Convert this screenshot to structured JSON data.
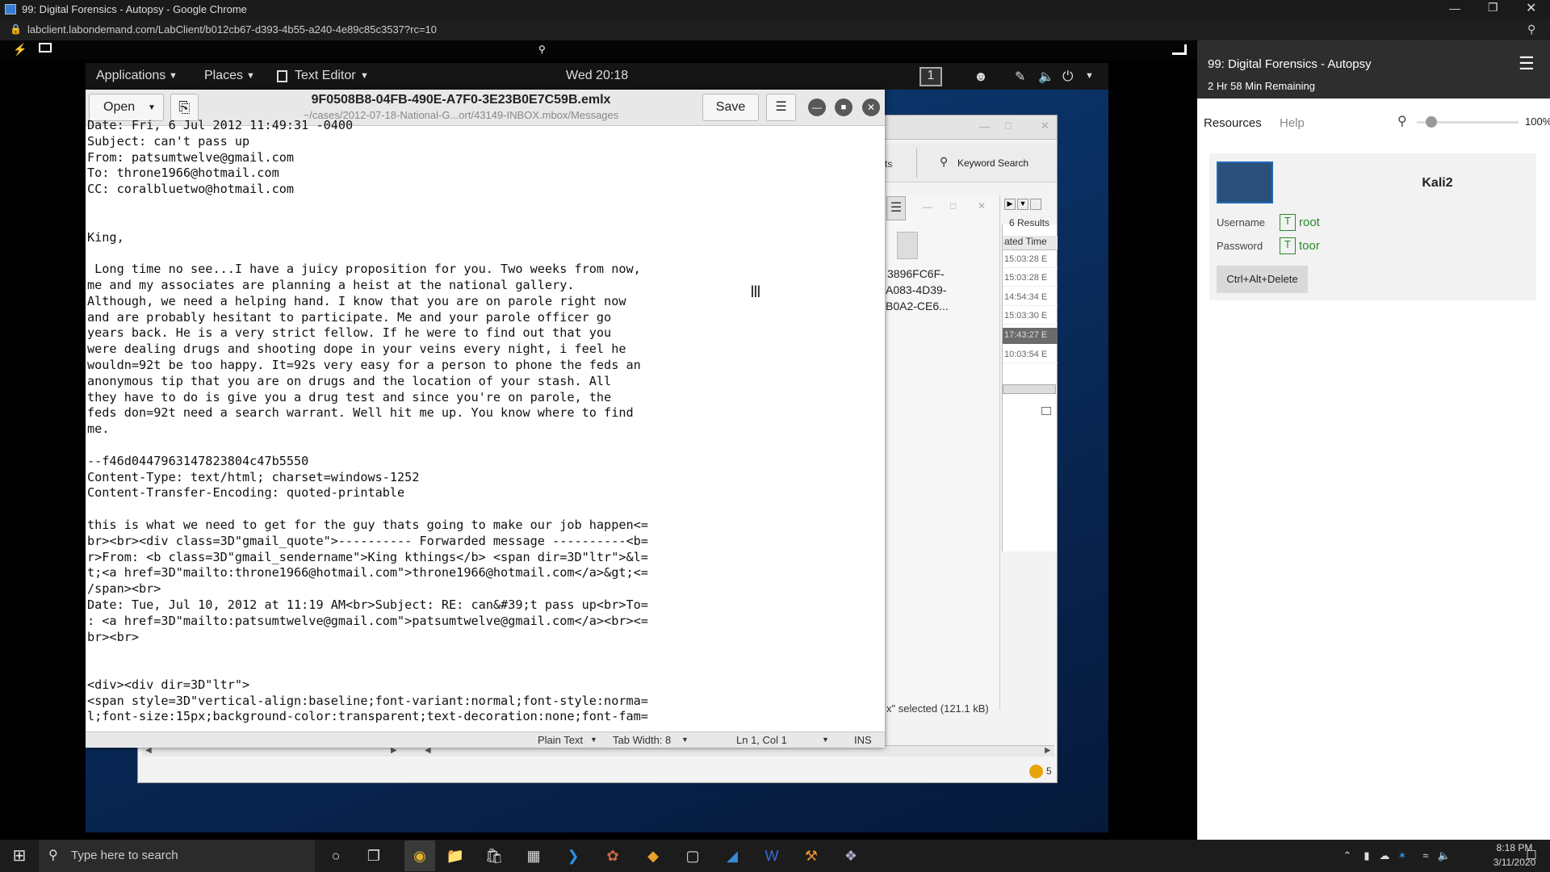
{
  "browser": {
    "tab_title": "99: Digital Forensics - Autopsy - Google Chrome",
    "url": "labclient.labondemand.com/LabClient/b012cb67-d393-4b55-a240-4e89c85c3537?rc=10"
  },
  "gnome": {
    "applications": "Applications",
    "places": "Places",
    "text_editor": "Text Editor",
    "clock": "Wed 20:18",
    "workspace": "1"
  },
  "editor": {
    "open_label": "Open",
    "title": "9F0508B8-04FB-490E-A7F0-3E23B0E7C59B.emlx",
    "subtitle": "~/cases/2012-07-18-National-G...ort/43149-INBOX.mbox/Messages",
    "save_label": "Save",
    "lines": [
      "Date: Fri, 6 Jul 2012 11:49:31 -0400",
      "Subject: can't pass up",
      "From: patsumtwelve@gmail.com",
      "To: throne1966@hotmail.com",
      "CC: coralbluetwo@hotmail.com",
      "",
      "",
      "King,",
      "",
      " Long time no see...I have a juicy proposition for you. Two weeks from now,",
      "me and my associates are planning a heist at the national gallery.",
      "Although, we need a helping hand. I know that you are on parole right now",
      "and are probably hesitant to participate. Me and your parole officer go",
      "years back. He is a very strict fellow. If he were to find out that you",
      "were dealing drugs and shooting dope in your veins every night, i feel he",
      "wouldn=92t be too happy. It=92s very easy for a person to phone the feds an",
      "anonymous tip that you are on drugs and the location of your stash. All",
      "they have to do is give you a drug test and since you're on parole, the",
      "feds don=92t need a search warrant. Well hit me up. You know where to find",
      "me.",
      "",
      "--f46d0447963147823804c47b5550",
      "Content-Type: text/html; charset=windows-1252",
      "Content-Transfer-Encoding: quoted-printable",
      "",
      "this is what we need to get for the guy thats going to make our job happen<=",
      "br><br><div class=3D\"gmail_quote\">---------- Forwarded message ----------<b=",
      "r>From: <b class=3D\"gmail_sendername\">King kthings</b> <span dir=3D\"ltr\">&l=",
      "t;<a href=3D\"mailto:throne1966@hotmail.com\">throne1966@hotmail.com</a>&gt;<=",
      "/span><br>",
      "Date: Tue, Jul 10, 2012 at 11:19 AM<br>Subject: RE: can&#39;t pass up<br>To=",
      ": <a href=3D\"mailto:patsumtwelve@gmail.com\">patsumtwelve@gmail.com</a><br><=",
      "br><br>",
      "",
      "",
      "<div><div dir=3D\"ltr\">",
      "<span style=3D\"vertical-align:baseline;font-variant:normal;font-style:norma=",
      "l;font-size:15px;background-color:transparent;text-decoration:none;font-fam="
    ],
    "status": {
      "mode": "Plain Text",
      "tab_width": "Tab Width: 8",
      "position": "Ln 1, Col 1",
      "ins": "INS"
    }
  },
  "autopsy": {
    "tab_partial": "ts",
    "keyword_search": "Keyword Search",
    "results": "6 Results",
    "column_header": "ated Time",
    "times": [
      "15:03:28 E",
      "15:03:28 E",
      "14:54:34 E",
      "15:03:30 E",
      "17:43:27 E",
      "10:03:54 E"
    ],
    "file_name_lines": [
      "3896FC6F-",
      "A083-4D39-",
      "B0A2-CE6..."
    ],
    "selected_status": "x\" selected  (121.1 kB)",
    "notification_count": "5"
  },
  "lab": {
    "title": "99: Digital Forensics - Autopsy",
    "remaining": "2 Hr 58 Min Remaining",
    "tabs": [
      "Resources",
      "Help"
    ],
    "zoom": "100%",
    "zoom_level": 0.1,
    "vm_name": "Kali2",
    "username_label": "Username",
    "username": "root",
    "password_label": "Password",
    "password": "toor",
    "cad_button": "Ctrl+Alt+Delete"
  },
  "taskbar": {
    "search_placeholder": "Type here to search",
    "time": "8:18 PM",
    "date": "3/11/2020"
  }
}
